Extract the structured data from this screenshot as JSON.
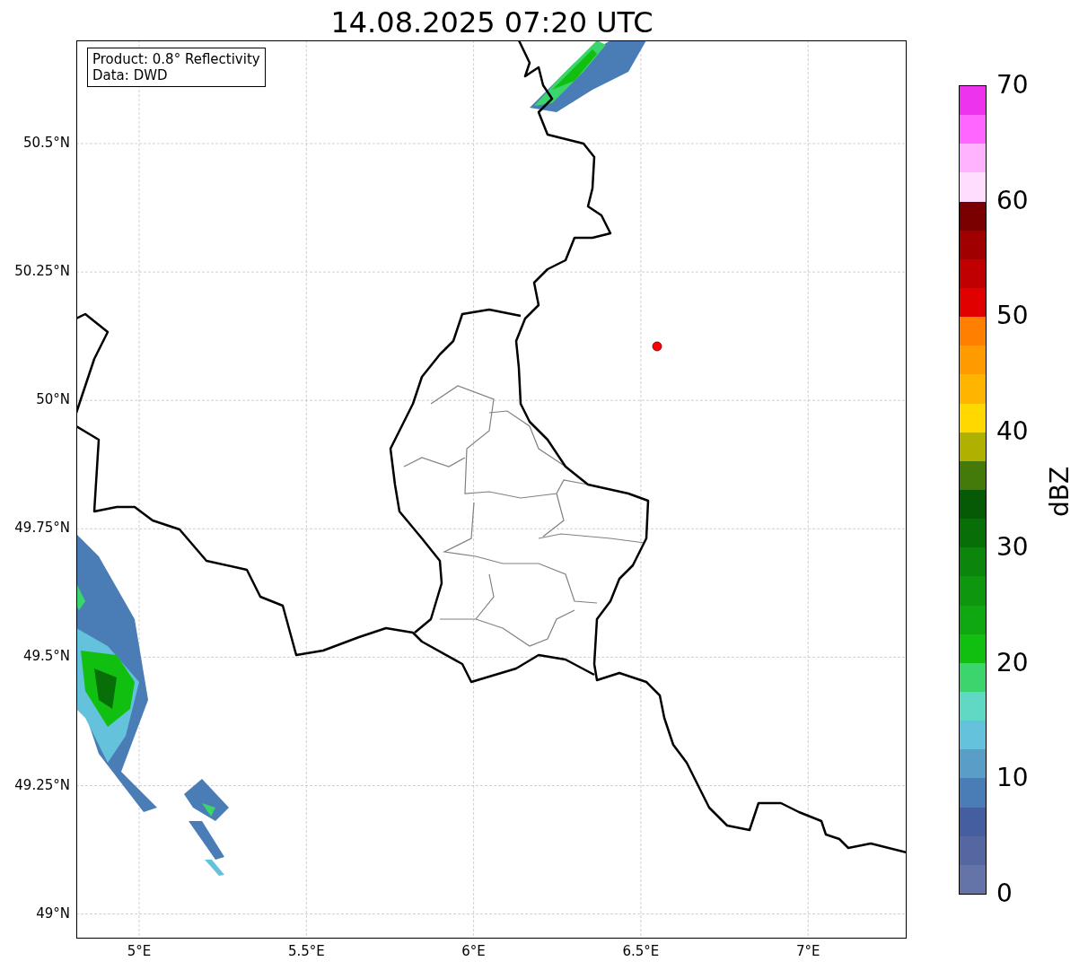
{
  "title": "14.08.2025 07:20 UTC",
  "info_box": [
    "Product: 0.8° Reflectivity",
    "Data: DWD"
  ],
  "lat_ticks": [
    "50.5°N",
    "50.25°N",
    "50°N",
    "49.75°N",
    "49.5°N",
    "49.25°N",
    "49°N"
  ],
  "lon_ticks": [
    "5°E",
    "5.5°E",
    "6°E",
    "6.5°E",
    "7°E"
  ],
  "colorbar": {
    "label": "dBZ",
    "ticks": [
      "70",
      "60",
      "50",
      "40",
      "30",
      "20",
      "10",
      "0"
    ],
    "bins": [
      {
        "color": "#ee33ee"
      },
      {
        "color": "#ff66ff"
      },
      {
        "color": "#ffb3ff"
      },
      {
        "color": "#ffddff"
      },
      {
        "color": "#7a0000"
      },
      {
        "color": "#a00000"
      },
      {
        "color": "#c00000"
      },
      {
        "color": "#e00000"
      },
      {
        "color": "#ff7f00"
      },
      {
        "color": "#ff9a00"
      },
      {
        "color": "#ffb400"
      },
      {
        "color": "#ffd800"
      },
      {
        "color": "#afb000"
      },
      {
        "color": "#447a0a"
      },
      {
        "color": "#065a06"
      },
      {
        "color": "#086e08"
      },
      {
        "color": "#0b850b"
      },
      {
        "color": "#0e960e"
      },
      {
        "color": "#10a810"
      },
      {
        "color": "#11bf11"
      },
      {
        "color": "#3cd46c"
      },
      {
        "color": "#5fd8c4"
      },
      {
        "color": "#65c2dc"
      },
      {
        "color": "#5a9ec8"
      },
      {
        "color": "#4a7db5"
      },
      {
        "color": "#445ea0"
      },
      {
        "color": "#5467a0"
      },
      {
        "color": "#6474a8"
      }
    ]
  }
}
